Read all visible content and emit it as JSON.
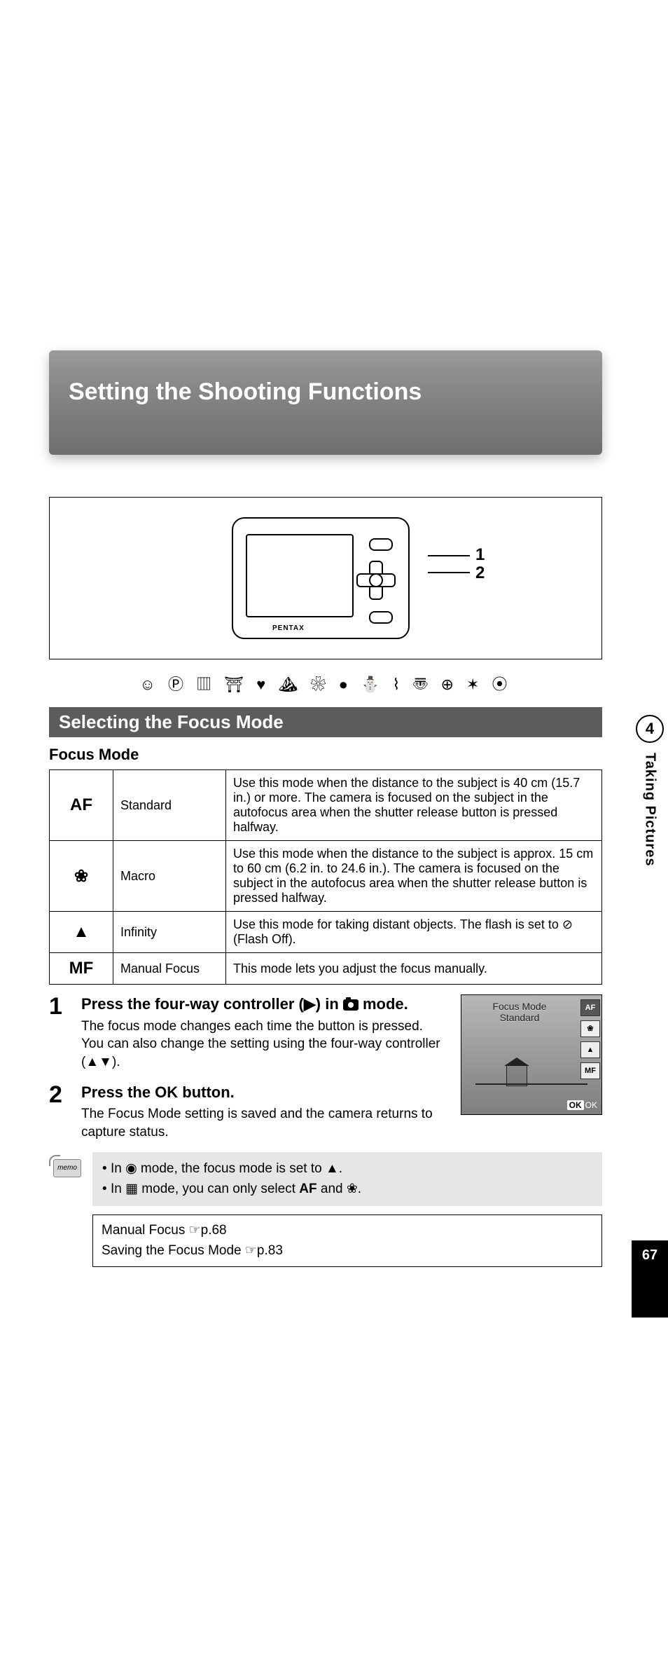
{
  "title": "Setting the Shooting Functions",
  "callouts": {
    "one": "1",
    "two": "2"
  },
  "brand": "PENTAX",
  "mode_icons": "☺ Ⓟ ▥ ⛩ ♥ ⛰ ❀ ● ⛄ ⌇ 〠 ⊕ ✶ ⦿",
  "section": "Selecting the Focus Mode",
  "table_title": "Focus Mode",
  "table": [
    {
      "icon": "AF",
      "name": "Standard",
      "desc": "Use this mode when the distance to the subject is 40 cm (15.7 in.) or more. The camera is focused on the subject in the autofocus area when the shutter release button is pressed halfway."
    },
    {
      "icon": "❀",
      "name": "Macro",
      "desc": "Use this mode when the distance to the subject is approx. 15 cm to 60 cm (6.2 in. to 24.6 in.). The camera is focused on the subject in the autofocus area when the shutter release button is pressed halfway."
    },
    {
      "icon": "▲",
      "name": "Infinity",
      "desc": "Use this mode for taking distant objects. The flash is set to ⊘ (Flash Off)."
    },
    {
      "icon": "MF",
      "name": "Manual Focus",
      "desc": "This mode lets you adjust the focus manually."
    }
  ],
  "steps": [
    {
      "num": "1",
      "title_a": "Press the four-way controller (▶) in ",
      "title_b": " mode.",
      "desc": "The focus mode changes each time the button is pressed. You can also change the setting using the four-way controller (▲▼)."
    },
    {
      "num": "2",
      "title": "Press the OK button.",
      "desc": "The Focus Mode setting is saved and the camera returns to capture status."
    }
  ],
  "preview": {
    "title1": "Focus Mode",
    "title2": "Standard",
    "side": [
      "AF",
      "❀",
      "▲",
      "MF"
    ],
    "ok": "OK"
  },
  "memo": {
    "label": "memo",
    "line1a": "In ",
    "line1b": " mode, the focus mode is set to ",
    "line1c": ".",
    "icon1": "◉",
    "icon1b": "▲",
    "line2a": "In ",
    "line2b": " mode, you can only select ",
    "line2c": " and ",
    "line2d": ".",
    "icon2": "▦",
    "af": "AF",
    "macro": "❀"
  },
  "refs": {
    "line1": "Manual Focus ☞p.68",
    "line2": "Saving the Focus Mode ☞p.83"
  },
  "side": {
    "chapter": "4",
    "label": "Taking Pictures",
    "page": "67"
  }
}
